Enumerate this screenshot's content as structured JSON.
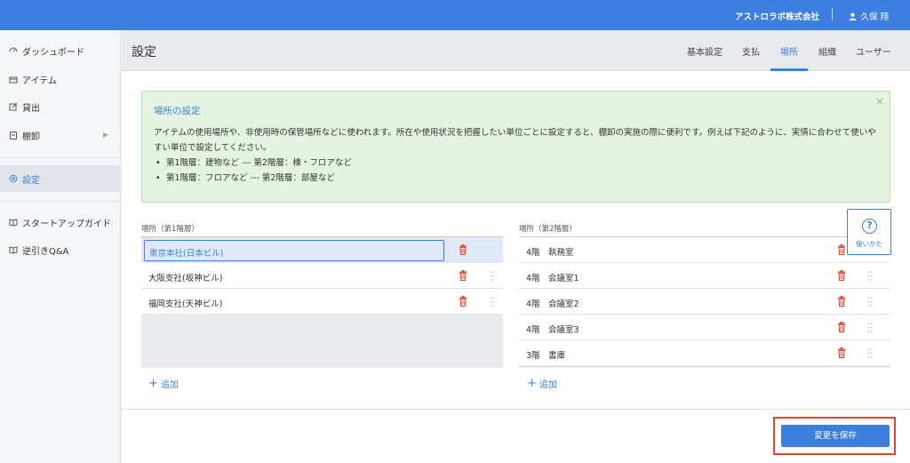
{
  "topbar": {
    "company": "アストロラボ株式会社",
    "user": "久保 翔"
  },
  "sidebar": {
    "items": [
      {
        "label": "ダッシュボード",
        "icon": "dashboard-icon"
      },
      {
        "label": "アイテム",
        "icon": "box-icon"
      },
      {
        "label": "貸出",
        "icon": "export-icon"
      },
      {
        "label": "棚卸",
        "icon": "clipboard-icon",
        "arrow": "▶"
      },
      {
        "label": "設定",
        "icon": "settings-icon"
      },
      {
        "label": "スタートアップガイド",
        "icon": "book-icon"
      },
      {
        "label": "逆引きQ&A",
        "icon": "book-icon"
      }
    ]
  },
  "header": {
    "title": "設定",
    "tabs": [
      {
        "label": "基本設定"
      },
      {
        "label": "支払"
      },
      {
        "label": "場所"
      },
      {
        "label": "組織"
      },
      {
        "label": "ユーザー"
      }
    ],
    "active_tab": "場所"
  },
  "info": {
    "close": "×",
    "title": "場所の設定",
    "body": "アイテムの使用場所や、非使用時の保管場所などに使われます。所在や使用状況を把握したい単位ごとに設定すると、棚卸の実施の際に便利です。例えば下記のように、実情に合わせて使いやすい単位で設定してください。",
    "bullets": [
      "第1階層：建物など --- 第2階層：棟・フロアなど",
      "第1階層：フロアなど --- 第2階層：部屋など"
    ]
  },
  "level1": {
    "label": "場所（第1階層）",
    "rows": [
      "東京本社(日本ビル)",
      "大阪支社(坂神ビル)",
      "福岡支社(天神ビル)"
    ],
    "add": "追加"
  },
  "level2": {
    "label": "場所（第2階層）",
    "rows": [
      "4階　執務室",
      "4階　会議室1",
      "4階　会議室2",
      "4階　会議室3",
      "3階　書庫"
    ],
    "add": "追加"
  },
  "help": {
    "symbol": "?",
    "label": "使いかた"
  },
  "save_button": "変更を保存",
  "colors": {
    "primary": "#3d7fe0",
    "danger": "#e2452f",
    "info_bg": "#e4f4e1",
    "highlight": "#e2452f"
  }
}
